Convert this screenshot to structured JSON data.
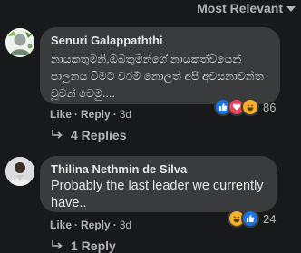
{
  "sort": {
    "label": "Most Relevant"
  },
  "comments": [
    {
      "author": "Senuri Galappaththi",
      "text": "නායකතුමනි,ඔබතුමන්ගේ නායකත්වයෙන් පාලනය වීමට වරම් නොලත් අපි අවසනාවන්ත වූවන් වෙමු....",
      "actions": {
        "like": "Like",
        "reply": "Reply",
        "time": "3d"
      },
      "reactions": {
        "icons": [
          "like-icon",
          "love-icon",
          "haha-icon"
        ],
        "count": "86"
      },
      "replies": "4 Replies"
    },
    {
      "author": "Thilina Nethmin de Silva",
      "text": "Probably the last leader we currently have..",
      "actions": {
        "like": "Like",
        "reply": "Reply",
        "time": "3d"
      },
      "reactions": {
        "icons": [
          "haha-icon",
          "like-icon"
        ],
        "count": "24"
      },
      "replies": "1 Reply"
    }
  ],
  "colors": {
    "background": "#18191a",
    "bubble": "#3a3b3c",
    "text": "#e4e6eb",
    "muted": "#b0b3b8",
    "like": "#1b74e4",
    "love": "#f33e58",
    "haha": "#f7b125"
  }
}
